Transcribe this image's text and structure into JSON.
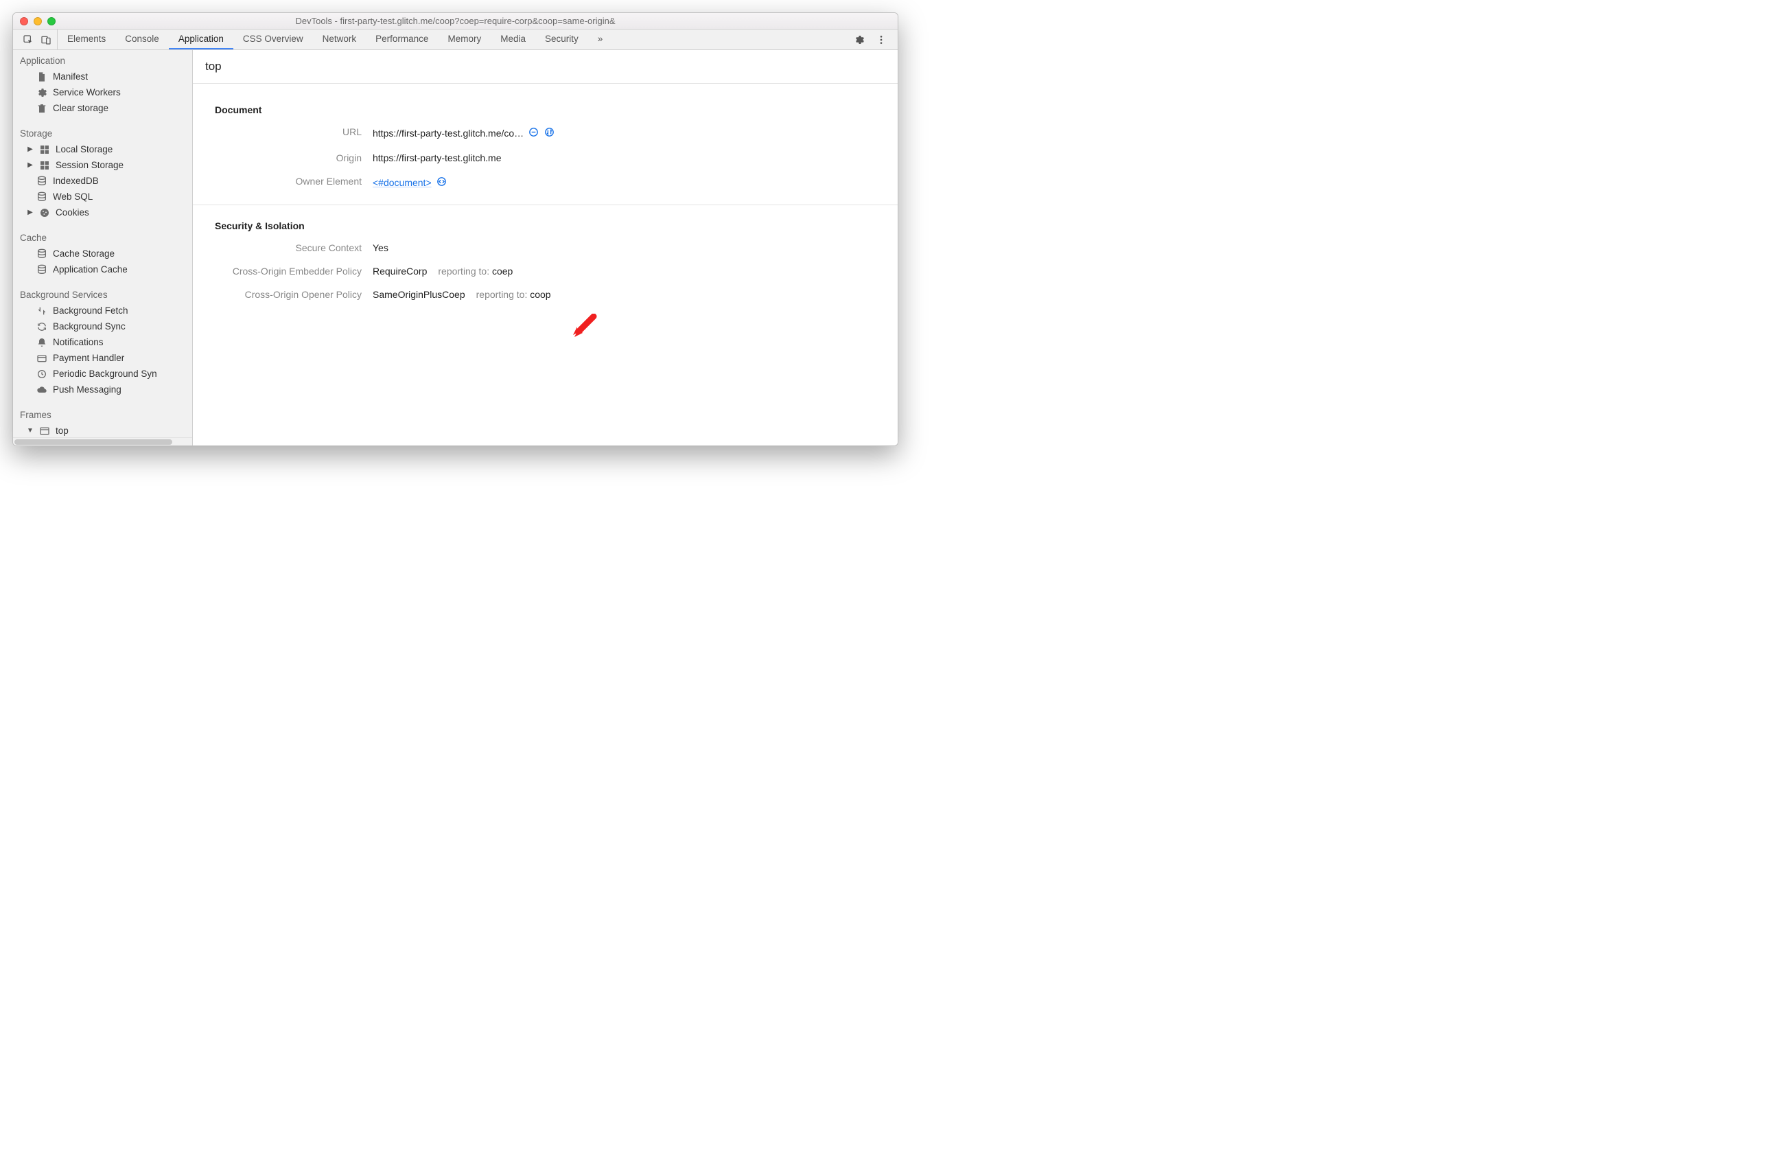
{
  "window": {
    "title": "DevTools - first-party-test.glitch.me/coop?coep=require-corp&coop=same-origin&"
  },
  "tabs": {
    "items": [
      "Elements",
      "Console",
      "Application",
      "CSS Overview",
      "Network",
      "Performance",
      "Memory",
      "Media",
      "Security"
    ],
    "activeIndex": 2,
    "overflow": "»"
  },
  "sidebar": {
    "sections": [
      {
        "title": "Application",
        "items": [
          {
            "icon": "document-icon",
            "label": "Manifest"
          },
          {
            "icon": "gear-icon",
            "label": "Service Workers"
          },
          {
            "icon": "trash-icon",
            "label": "Clear storage"
          }
        ]
      },
      {
        "title": "Storage",
        "items": [
          {
            "icon": "grid-icon",
            "label": "Local Storage",
            "expandable": true
          },
          {
            "icon": "grid-icon",
            "label": "Session Storage",
            "expandable": true
          },
          {
            "icon": "database-icon",
            "label": "IndexedDB"
          },
          {
            "icon": "database-icon",
            "label": "Web SQL"
          },
          {
            "icon": "cookie-icon",
            "label": "Cookies",
            "expandable": true
          }
        ]
      },
      {
        "title": "Cache",
        "items": [
          {
            "icon": "database-icon",
            "label": "Cache Storage"
          },
          {
            "icon": "database-icon",
            "label": "Application Cache"
          }
        ]
      },
      {
        "title": "Background Services",
        "items": [
          {
            "icon": "fetch-icon",
            "label": "Background Fetch"
          },
          {
            "icon": "sync-icon",
            "label": "Background Sync"
          },
          {
            "icon": "bell-icon",
            "label": "Notifications"
          },
          {
            "icon": "card-icon",
            "label": "Payment Handler"
          },
          {
            "icon": "clock-icon",
            "label": "Periodic Background Syn"
          },
          {
            "icon": "cloud-icon",
            "label": "Push Messaging"
          }
        ]
      },
      {
        "title": "Frames",
        "items": [
          {
            "icon": "window-icon",
            "label": "top",
            "expandable": true,
            "expanded": true
          }
        ]
      }
    ]
  },
  "main": {
    "heading": "top",
    "document": {
      "section_title": "Document",
      "url_label": "URL",
      "url_value": "https://first-party-test.glitch.me/co…",
      "origin_label": "Origin",
      "origin_value": "https://first-party-test.glitch.me",
      "owner_label": "Owner Element",
      "owner_value": "<#document>"
    },
    "security": {
      "section_title": "Security & Isolation",
      "secure_label": "Secure Context",
      "secure_value": "Yes",
      "coep_label": "Cross-Origin Embedder Policy",
      "coep_value": "RequireCorp",
      "coep_reporting_label": "reporting to:",
      "coep_reporting_value": "coep",
      "coop_label": "Cross-Origin Opener Policy",
      "coop_value": "SameOriginPlusCoep",
      "coop_reporting_label": "reporting to:",
      "coop_reporting_value": "coop"
    }
  },
  "colors": {
    "link": "#1a73e8",
    "tabActive": "#4285f4",
    "annotationRed": "#f02020"
  }
}
